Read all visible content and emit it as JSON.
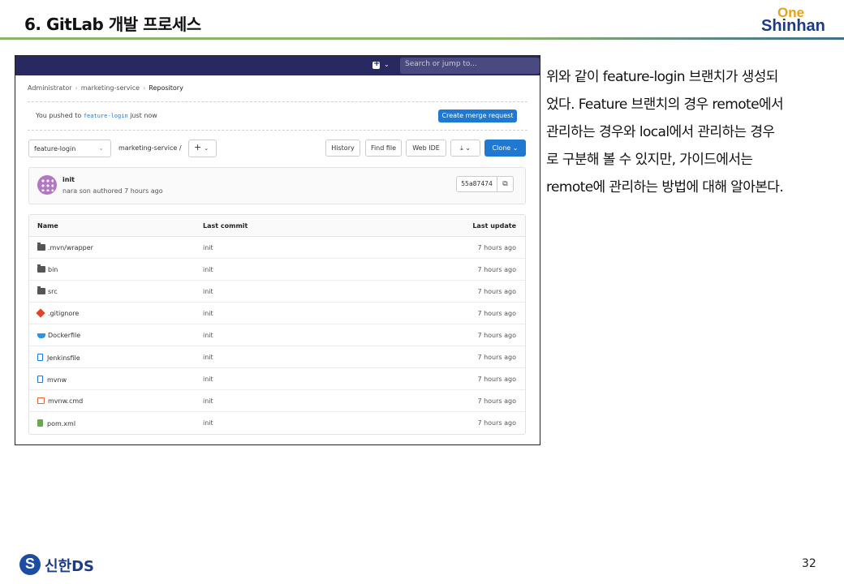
{
  "slide": {
    "title": "6. GitLab 개발 프로세스",
    "logo_one": "One",
    "logo_shinhan": "Shinhan",
    "footer_brand": "신한DS",
    "page_number": "32",
    "description_lines": [
      "위와 같이 feature-login 브랜치가 생성되",
      "었다. Feature 브랜치의 경우 remote에서",
      "관리하는 경우와 local에서 관리하는 경우",
      "로 구분해 볼 수 있지만, 가이드에서는",
      "remote에 관리하는 방법에 대해 알아본다."
    ]
  },
  "gitlab": {
    "search_placeholder": "Search or jump to...",
    "breadcrumbs": [
      "Administrator",
      "marketing-service",
      "Repository"
    ],
    "push_prefix": "You pushed to",
    "push_branch": "feature-login",
    "push_suffix": "just now",
    "create_mr_label": "Create merge request",
    "branch": "feature-login",
    "path": "marketing-service",
    "path_sep": "/",
    "add_label": "+",
    "buttons": {
      "history": "History",
      "find_file": "Find file",
      "web_ide": "Web IDE",
      "download": "⤓",
      "clone": "Clone"
    },
    "commit": {
      "title": "init",
      "meta": "nara son authored 7 hours ago",
      "sha": "55a87474"
    },
    "table": {
      "headers": [
        "Name",
        "Last commit",
        "Last update"
      ],
      "rows": [
        {
          "icon": "folder-icon",
          "name": ".mvn/wrapper",
          "commit": "init",
          "updated": "7 hours ago"
        },
        {
          "icon": "folder-icon",
          "name": "bin",
          "commit": "init",
          "updated": "7 hours ago"
        },
        {
          "icon": "folder-icon",
          "name": "src",
          "commit": "init",
          "updated": "7 hours ago"
        },
        {
          "icon": "git-icon",
          "name": ".gitignore",
          "commit": "init",
          "updated": "7 hours ago"
        },
        {
          "icon": "docker-icon",
          "name": "Dockerfile",
          "commit": "init",
          "updated": "7 hours ago"
        },
        {
          "icon": "file-icon",
          "name": "Jenkinsfile",
          "commit": "init",
          "updated": "7 hours ago"
        },
        {
          "icon": "file-icon",
          "name": "mvnw",
          "commit": "init",
          "updated": "7 hours ago"
        },
        {
          "icon": "terminal-file-icon",
          "name": "mvnw.cmd",
          "commit": "init",
          "updated": "7 hours ago"
        },
        {
          "icon": "xml-file-icon",
          "name": "pom.xml",
          "commit": "init",
          "updated": "7 hours ago"
        }
      ]
    }
  },
  "colors": {
    "topbar": "#292961",
    "primary": "#1f78d1",
    "brand_blue": "#1b3a8a",
    "brand_gold": "#e3a21a"
  }
}
